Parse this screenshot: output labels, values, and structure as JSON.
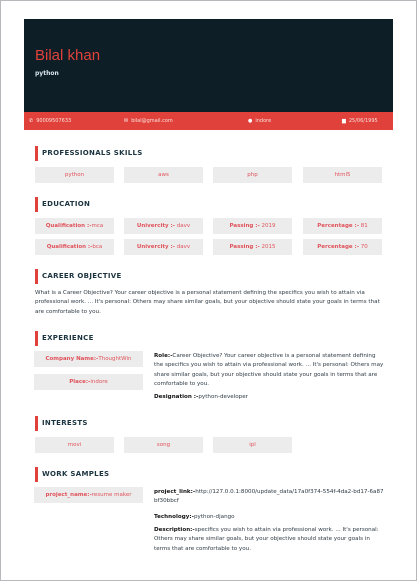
{
  "header": {
    "name": "Bilal khan",
    "title": "python"
  },
  "contact": {
    "phone": "90009507633",
    "email": "bilal@gmail.com",
    "location": "indore",
    "dob": "25/06/1995"
  },
  "skills": {
    "heading": "PROFESSIONALS SKILLS",
    "items": [
      "python",
      "aws",
      "php",
      "html5"
    ]
  },
  "education": {
    "heading": "EDUCATION",
    "rows": [
      {
        "qualification_label": "Qualification :-",
        "qualification": "mca",
        "university_label": "Univercity :-",
        "university": "davv",
        "passing_label": "Passing :-",
        "passing": "2019",
        "percentage_label": "Percentage :-",
        "percentage": "81"
      },
      {
        "qualification_label": "Qualification :-",
        "qualification": "bca",
        "university_label": "Univercity :-",
        "university": "davv",
        "passing_label": "Passing :-",
        "passing": "2015",
        "percentage_label": "Percentage :-",
        "percentage": "70"
      }
    ]
  },
  "objective": {
    "heading": "CAREER OBJECTIVE",
    "text": "What is a Career Objective? Your career objective is a personal statement defining the specifics you wish to attain via professional work. ... It's personal: Others may share similar goals, but your objective should state your goals in terms that are comfortable to you."
  },
  "experience": {
    "heading": "EXPERIENCE",
    "company_label": "Company Name:-",
    "company": "ThoughtWin",
    "place_label": "Place:-",
    "place": "indore",
    "role_label": "Role:-",
    "role": "Career Objective? Your career objective is a personal statement defining the specifics you wish to attain via professional work. ... It's personal: Others may share similar goals, but your objective should state your goals in terms that are comfortable to you.",
    "designation_label": "Designation :-",
    "designation": "python-developer"
  },
  "interests": {
    "heading": "INTERESTS",
    "items": [
      "movi",
      "song",
      "ipl"
    ]
  },
  "work": {
    "heading": "WORK SAMPLES",
    "project_name_label": "project_name:-",
    "project_name": "resume maker",
    "link_label": "project_link:-",
    "link": "http://127.0.0.1:8000/update_data/17a0f374-554f-4da2-bd17-6a87bf30bbcf",
    "tech_label": "Technology:-",
    "tech": "python-django",
    "desc_label": "Description:-",
    "desc": "specifics you wish to attain via professional work. ... It's personal: Others may share similar goals, but your objective should state your goals in terms that are comfortable to you."
  }
}
